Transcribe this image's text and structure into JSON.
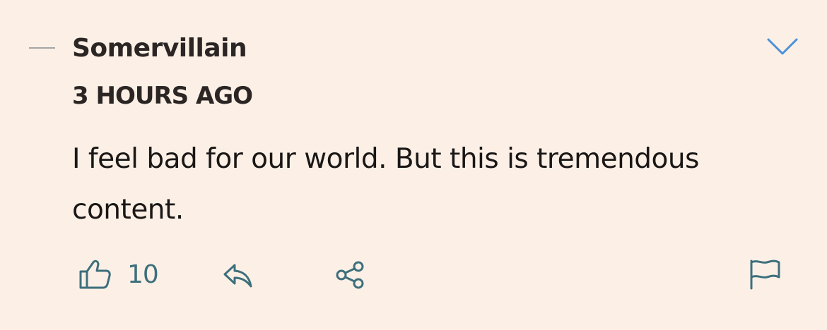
{
  "comment": {
    "author": "Somervillain",
    "timestamp": "3 HOURS AGO",
    "body": "I feel bad for our world. But this is tremendous content."
  },
  "actions": {
    "like_count": "10",
    "like_icon": "thumbs-up-icon",
    "reply_icon": "reply-icon",
    "share_icon": "share-icon",
    "flag_icon": "flag-icon"
  },
  "colors": {
    "background": "#fcf0e6",
    "accent_teal": "#3d6f7c",
    "chevron_blue": "#4a90d9",
    "text": "#2b2624",
    "collapse_dash": "#a5a5a5"
  }
}
